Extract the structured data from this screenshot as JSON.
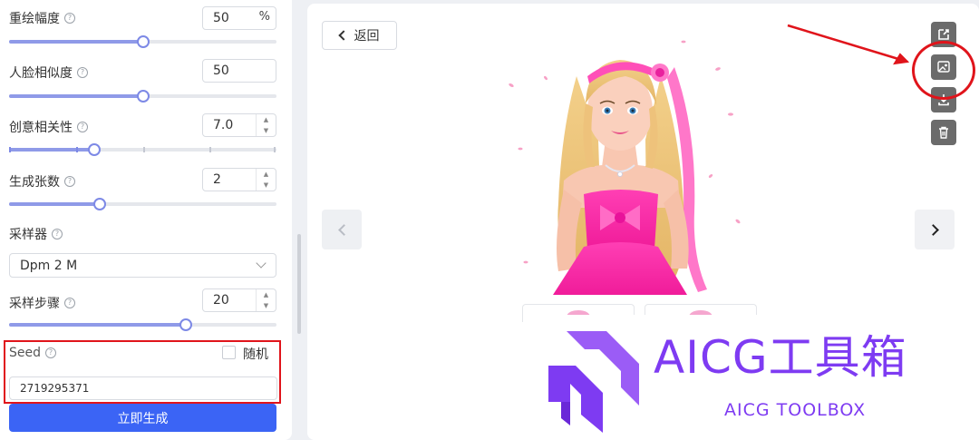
{
  "params": {
    "redraw": {
      "label": "重绘幅度",
      "value": "50",
      "unit": "%",
      "level_pct": 50
    },
    "face_similarity": {
      "label": "人脸相似度",
      "value": "50",
      "level_pct": 50
    },
    "creativity": {
      "label": "创意相关性",
      "value": "7.0",
      "level_pct": 32
    },
    "count": {
      "label": "生成张数",
      "value": "2",
      "level_pct": 34
    },
    "sampler": {
      "label": "采样器",
      "value": "Dpm 2 M"
    },
    "steps": {
      "label": "采样步骤",
      "value": "20",
      "level_pct": 66
    }
  },
  "seed": {
    "label": "Seed",
    "random_label": "随机",
    "value": "2719295371"
  },
  "generate_label": "立即生成",
  "preview": {
    "back_label": "返回"
  },
  "icons": {
    "share": "share-icon",
    "image_edit": "image-edit-icon",
    "download": "download-icon",
    "delete": "trash-icon"
  },
  "watermark": {
    "title": "AICG工具箱",
    "subtitle": "AICG TOOLBOX"
  },
  "colors": {
    "accent": "#3b64f5",
    "slider": "#7d89e6",
    "highlight": "#e0141b",
    "brand": "#7e3bf2"
  }
}
